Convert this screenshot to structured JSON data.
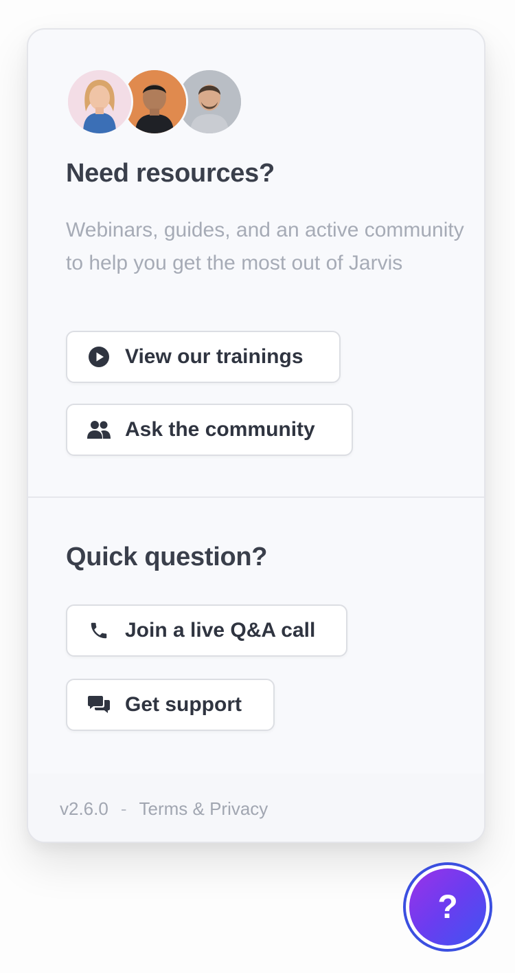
{
  "panel": {
    "resources": {
      "heading": "Need resources?",
      "description": "Webinars, guides, and an active community to help you get the most out of Jarvis",
      "buttons": [
        {
          "label": "View our trainings",
          "icon": "play-circle-icon"
        },
        {
          "label": "Ask the community",
          "icon": "people-icon"
        }
      ]
    },
    "quick": {
      "heading": "Quick question?",
      "buttons": [
        {
          "label": "Join a live Q&A call",
          "icon": "phone-icon"
        },
        {
          "label": "Get support",
          "icon": "chat-bubbles-icon"
        }
      ]
    },
    "footer": {
      "version": "v2.6.0",
      "separator": "-",
      "link": "Terms & Privacy"
    }
  },
  "help_button": {
    "label": "?",
    "icon": "question-mark-icon"
  },
  "colors": {
    "accent_start": "#9b32e8",
    "accent_end": "#3e55f2",
    "heading": "#3a3f4b",
    "muted": "#a6abb6"
  }
}
